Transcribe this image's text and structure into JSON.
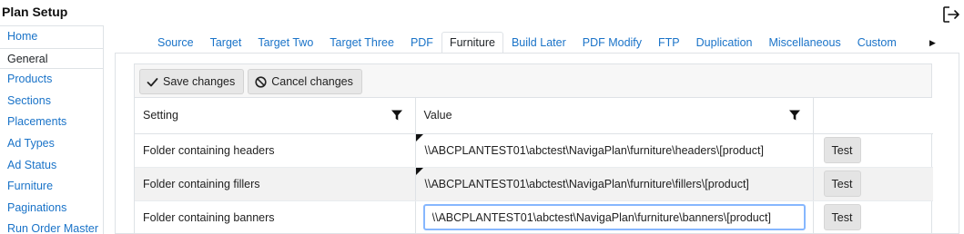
{
  "page": {
    "title": "Plan Setup"
  },
  "sidebar": {
    "items": [
      {
        "label": "Home"
      },
      {
        "label": "General"
      },
      {
        "label": "Products"
      },
      {
        "label": "Sections"
      },
      {
        "label": "Placements"
      },
      {
        "label": "Ad Types"
      },
      {
        "label": "Ad Status"
      },
      {
        "label": "Furniture"
      },
      {
        "label": "Paginations"
      },
      {
        "label": "Run Order Master"
      }
    ],
    "active": "General"
  },
  "tabs": {
    "items": [
      {
        "label": "Source"
      },
      {
        "label": "Target"
      },
      {
        "label": "Target Two"
      },
      {
        "label": "Target Three"
      },
      {
        "label": "PDF"
      },
      {
        "label": "Furniture"
      },
      {
        "label": "Build Later"
      },
      {
        "label": "PDF Modify"
      },
      {
        "label": "FTP"
      },
      {
        "label": "Duplication"
      },
      {
        "label": "Miscellaneous"
      },
      {
        "label": "Custom"
      }
    ],
    "active": "Furniture"
  },
  "toolbar": {
    "save_label": "Save changes",
    "cancel_label": "Cancel changes"
  },
  "grid": {
    "columns": {
      "setting": "Setting",
      "value": "Value"
    },
    "rows": [
      {
        "setting": "Folder containing headers",
        "value": "\\\\ABCPLANTEST01\\abctest\\NavigaPlan\\furniture\\headers\\[product]",
        "action": "Test"
      },
      {
        "setting": "Folder containing fillers",
        "value": "\\\\ABCPLANTEST01\\abctest\\NavigaPlan\\furniture\\fillers\\[product]",
        "action": "Test"
      },
      {
        "setting": "Folder containing banners",
        "value": "\\\\ABCPLANTEST01\\abctest\\NavigaPlan\\furniture\\banners\\[product]",
        "action": "Test"
      }
    ]
  },
  "icons": {
    "logout": "logout-icon",
    "filter": "filter-icon",
    "save": "checkmark-icon",
    "cancel": "cancel-circle-icon",
    "scroll": "scroll-right-icon"
  },
  "colors": {
    "link": "#1a73c8",
    "focus_border": "#86b7fe",
    "row_alt": "#f2f2f2"
  }
}
